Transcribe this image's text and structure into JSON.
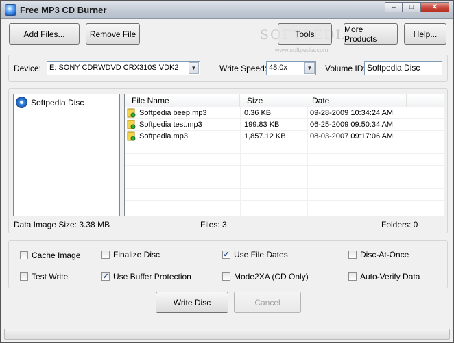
{
  "window": {
    "title": "Free MP3 CD Burner",
    "controls": {
      "minimize": "–",
      "maximize": "□",
      "close": "✕"
    }
  },
  "toolbar": {
    "add_files": "Add Files...",
    "remove_file": "Remove File",
    "tools": "Tools",
    "more_products": "More Products",
    "help": "Help..."
  },
  "watermark": {
    "logo": "SOFTPEDIA",
    "url": "www.softpedia.com"
  },
  "device_bar": {
    "device_label": "Device:",
    "device_value": "E: SONY CDRWDVD CRX310S VDK2",
    "write_speed_label": "Write Speed:",
    "write_speed_value": "48.0x",
    "volume_id_label": "Volume ID:",
    "volume_id_value": "Softpedia Disc"
  },
  "tree": {
    "items": [
      {
        "label": "Softpedia Disc",
        "icon": "disc-icon"
      }
    ]
  },
  "file_list": {
    "columns": [
      "File Name",
      "Size",
      "Date"
    ],
    "rows": [
      {
        "name": "Softpedia beep.mp3",
        "size": "0.36 KB",
        "date": "09-28-2009 10:34:24 AM",
        "icon": "mp3-file-icon"
      },
      {
        "name": "Softpedia test.mp3",
        "size": "199.83 KB",
        "date": "06-25-2009 09:50:34 AM",
        "icon": "mp3-file-icon"
      },
      {
        "name": "Softpedia.mp3",
        "size": "1,857.12 KB",
        "date": "08-03-2007 09:17:06 AM",
        "icon": "mp3-file-icon"
      }
    ]
  },
  "info": {
    "image_size": "Data Image Size: 3.38 MB",
    "files": "Files: 3",
    "folders": "Folders: 0"
  },
  "options": {
    "cache_image": {
      "label": "Cache Image",
      "checked": false
    },
    "finalize_disc": {
      "label": "Finalize Disc",
      "checked": false
    },
    "use_file_dates": {
      "label": "Use File Dates",
      "checked": true
    },
    "disc_at_once": {
      "label": "Disc-At-Once",
      "checked": false
    },
    "test_write": {
      "label": "Test Write",
      "checked": false
    },
    "use_buffer_protection": {
      "label": "Use Buffer Protection",
      "checked": true
    },
    "mode2xa": {
      "label": "Mode2XA (CD Only)",
      "checked": false
    },
    "auto_verify": {
      "label": "Auto-Verify Data",
      "checked": false
    },
    "check_mark": "✓"
  },
  "actions": {
    "write_disc": "Write Disc",
    "cancel": "Cancel"
  },
  "colors": {
    "panel_border": "#828790",
    "close_button": "#c7463a",
    "window_bg": "#f0f0f0"
  }
}
